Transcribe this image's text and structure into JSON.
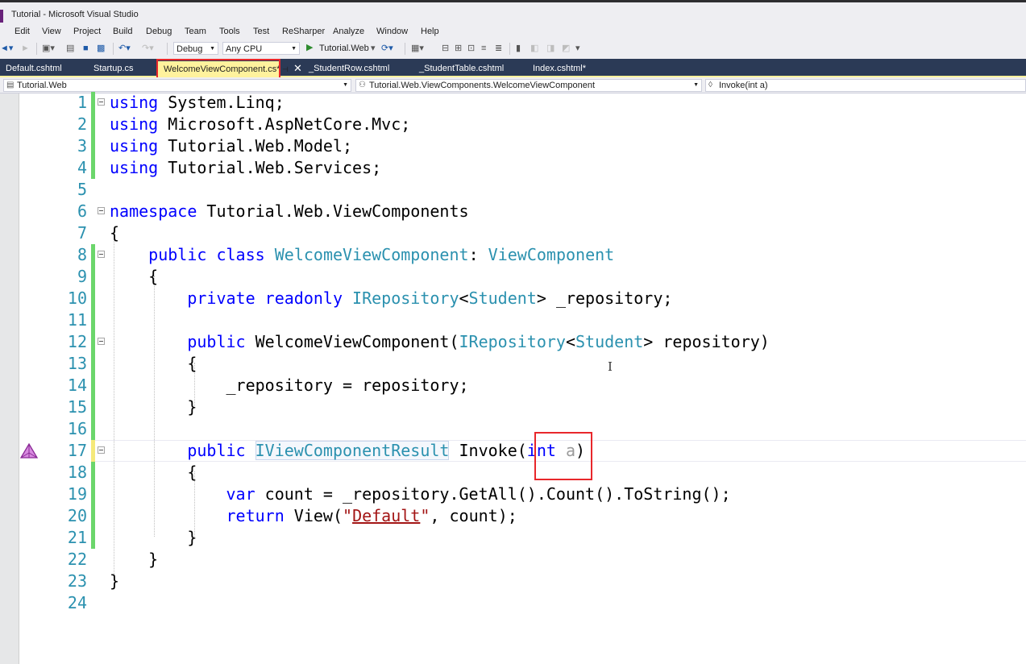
{
  "window": {
    "title": "Tutorial - Microsoft Visual Studio"
  },
  "menu": [
    "Edit",
    "View",
    "Project",
    "Build",
    "Debug",
    "Team",
    "Tools",
    "Test",
    "ReSharper",
    "Analyze",
    "Window",
    "Help"
  ],
  "toolbar": {
    "configuration": "Debug",
    "platform": "Any CPU",
    "run_target": "Tutorial.Web"
  },
  "tabs": [
    {
      "label": "Default.cshtml",
      "active": false
    },
    {
      "label": "Startup.cs",
      "active": false
    },
    {
      "label": "WelcomeViewComponent.cs*",
      "active": true
    },
    {
      "label": "_StudentRow.cshtml",
      "active": false
    },
    {
      "label": "_StudentTable.cshtml",
      "active": false
    },
    {
      "label": "Index.cshtml*",
      "active": false
    }
  ],
  "navigation": {
    "project": "Tutorial.Web",
    "type": "Tutorial.Web.ViewComponents.WelcomeViewComponent",
    "member": "Invoke(int a)"
  },
  "editor": {
    "line_numbers": [
      "1",
      "2",
      "3",
      "4",
      "5",
      "6",
      "7",
      "8",
      "9",
      "10",
      "11",
      "12",
      "13",
      "14",
      "15",
      "16",
      "17",
      "18",
      "19",
      "20",
      "21",
      "22",
      "23",
      "24"
    ],
    "tokens": {
      "using": "using",
      "ns_linq": "System.Linq;",
      "ns_mvc": "Microsoft.AspNetCore.Mvc;",
      "ns_model": "Tutorial.Web.Model;",
      "ns_services": "Tutorial.Web.Services;",
      "namespace": "namespace",
      "ns_name": "Tutorial.Web.ViewComponents",
      "open_brace": "{",
      "close_brace": "}",
      "public": "public",
      "class": "class",
      "class_name": "WelcomeViewComponent",
      "colon": ":",
      "base_class": "ViewComponent",
      "private": "private",
      "readonly": "readonly",
      "irepository": "IRepository",
      "lt": "<",
      "student": "Student",
      "gt": ">",
      "field_decl": "_repository;",
      "ctor_name": "WelcomeViewComponent(",
      "param_repo": "repository)",
      "assign": "_repository = repository;",
      "result_type": "IViewComponentResult",
      "invoke": "Invoke(",
      "int": "int",
      "param_a": "a",
      "paren_close": ")",
      "var": "var",
      "count_stmt": "count = _repository.GetAll().Count().ToString();",
      "return": "return",
      "view_call": "View(",
      "quote": "\"",
      "default_str": "Default",
      "view_tail": ", count);"
    }
  },
  "colors": {
    "keyword": "#0000ff",
    "type": "#2b91af",
    "string": "#a31515",
    "line_number": "#2b91af",
    "change_saved": "#6bd66b",
    "change_unsaved": "#f5e97a",
    "tab_strip": "#2b3a56",
    "active_tab": "#fff29d",
    "annotation": "#e8272b"
  }
}
